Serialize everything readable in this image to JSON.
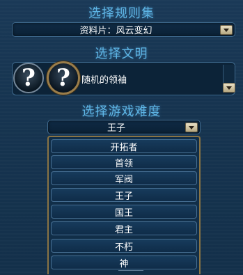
{
  "ruleset": {
    "title": "选择规则集",
    "selected": "资料片：风云变幻"
  },
  "civilization": {
    "title": "选择文明",
    "icon_glyph": "?",
    "leader": "随机的领袖"
  },
  "difficulty": {
    "title": "选择游戏难度",
    "selected": "王子",
    "options": [
      "开拓者",
      "首领",
      "军阀",
      "王子",
      "国王",
      "君主",
      "不朽",
      "神"
    ]
  },
  "icons": {
    "dropdown_arrow": "chevron-down-icon",
    "random_civ": "question-mark-icon"
  },
  "colors": {
    "title": "#5eb6e6",
    "panel_border": "#3f6a8e",
    "list_border": "#8a7444",
    "background": "#152e46"
  }
}
